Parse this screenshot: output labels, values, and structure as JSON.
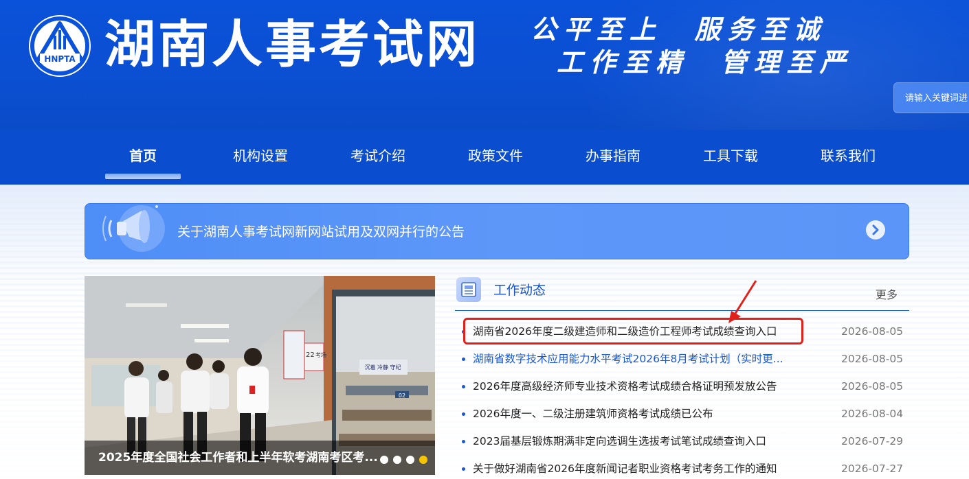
{
  "header": {
    "logo_text": "HNPTA",
    "site_name": "湖南人事考试网",
    "slogan_line1": "公平至上  服务至诚",
    "slogan_line2": "工作至精  管理至严",
    "search_placeholder": "请输入关键词进"
  },
  "nav": {
    "items": [
      {
        "label": "首页",
        "active": true
      },
      {
        "label": "机构设置"
      },
      {
        "label": "考试介绍"
      },
      {
        "label": "政策文件"
      },
      {
        "label": "办事指南"
      },
      {
        "label": "工具下载"
      },
      {
        "label": "联系我们"
      }
    ]
  },
  "notice": {
    "text": "关于湖南人事考试网新网站试用及双网并行的公告"
  },
  "carousel": {
    "caption": "2025年度全国社会工作者和上半年软考湖南考区考...",
    "dot_count": 4,
    "active_dot": 4,
    "photo_signs": {
      "wall_text": "沉着 冷静 守纪",
      "room_number": "02",
      "door_number": "22",
      "door_label": "考场"
    }
  },
  "news": {
    "section_title": "工作动态",
    "more_label": "更多",
    "items": [
      {
        "title": "湖南省2026年度二级建造师和二级造价工程师考试成绩查询入口",
        "date": "2026-08-05",
        "highlighted": true
      },
      {
        "title": "湖南省数字技术应用能力水平考试2026年8月考试计划（实时更...",
        "date": "2026-08-05",
        "blue": true
      },
      {
        "title": "2026年度高级经济师专业技术资格考试成绩合格证明预发放公告",
        "date": "2026-08-05"
      },
      {
        "title": "2026年度一、二级注册建筑师资格考试成绩已公布",
        "date": "2026-08-04"
      },
      {
        "title": "2023届基层锻炼期满非定向选调生选拔考试笔试成绩查询入口",
        "date": "2026-07-29"
      },
      {
        "title": "关于做好湖南省2026年度新闻记者职业资格考试考务工作的通知",
        "date": "2026-07-27"
      }
    ]
  },
  "colors": {
    "header_blue": "#0a52d9",
    "nav_blue": "#0a4ecf",
    "link_blue": "#1a58d0",
    "highlight_red": "#e0211b",
    "active_dot": "#f4c400"
  }
}
